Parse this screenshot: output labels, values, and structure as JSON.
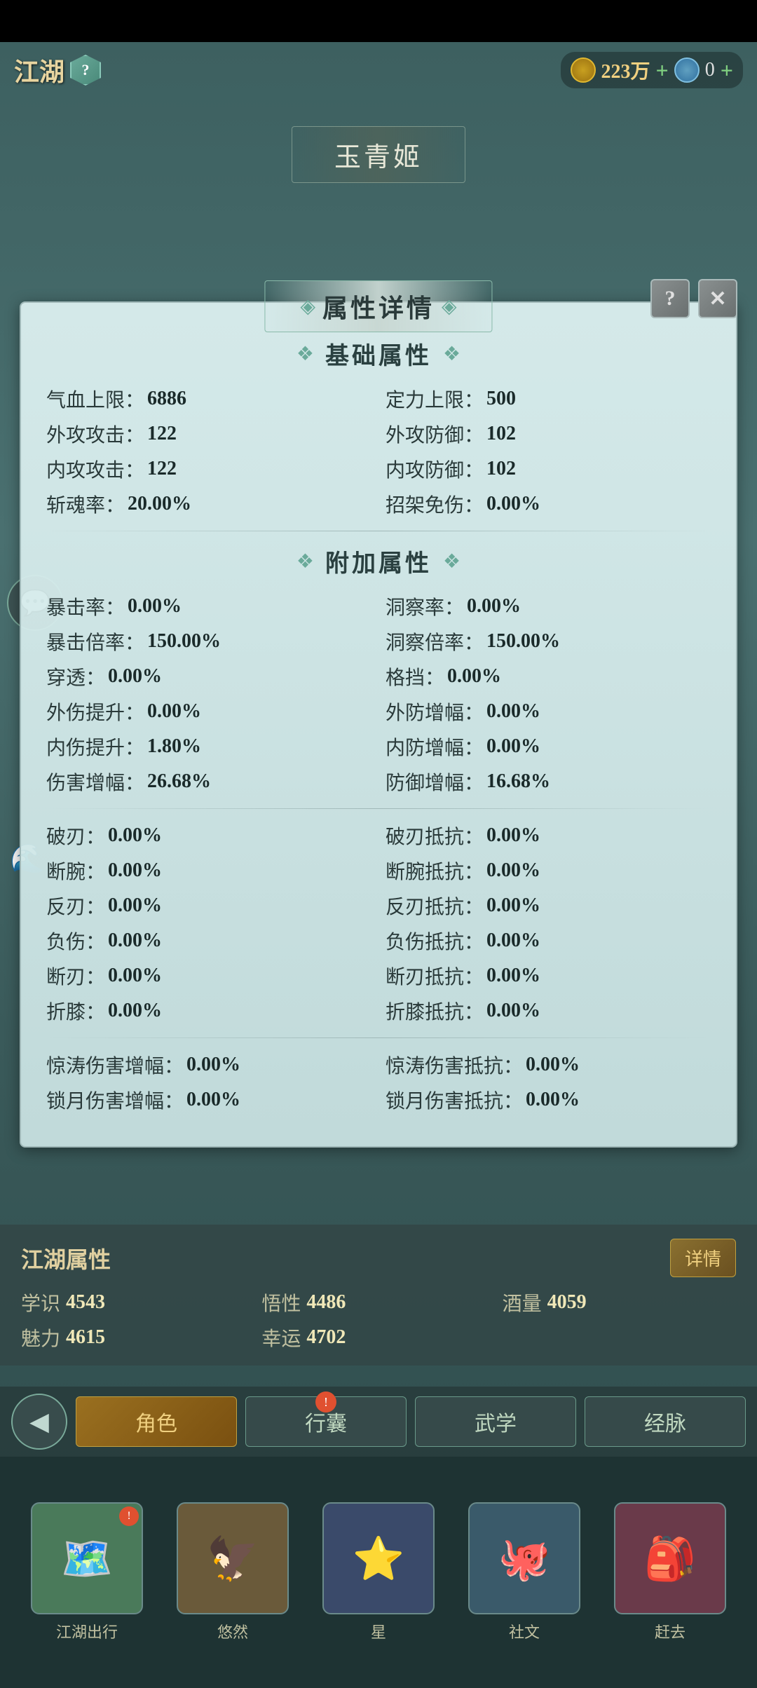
{
  "app": {
    "title": "江湖"
  },
  "top_hud": {
    "jianghu_label": "江湖",
    "question_mark": "?",
    "currency_amount": "223万",
    "currency_plus": "+",
    "gem_count": "0",
    "gem_plus": "+"
  },
  "character": {
    "name": "玉青姬"
  },
  "panel": {
    "title": "属性详情",
    "help_label": "?",
    "close_label": "✕",
    "basic_section": "基础属性",
    "addon_section": "附加属性",
    "deco_left": "❖",
    "deco_right": "❖"
  },
  "basic_stats": [
    {
      "label": "气血上限：",
      "value": "6886",
      "col": "left"
    },
    {
      "label": "定力上限：",
      "value": "500",
      "col": "right"
    },
    {
      "label": "外攻攻击：",
      "value": "122",
      "col": "left"
    },
    {
      "label": "外攻防御：",
      "value": "102",
      "col": "right"
    },
    {
      "label": "内攻攻击：",
      "value": "122",
      "col": "left"
    },
    {
      "label": "内攻防御：",
      "value": "102",
      "col": "right"
    },
    {
      "label": "斩魂率：",
      "value": "20.00%",
      "col": "left"
    },
    {
      "label": "招架免伤：",
      "value": "0.00%",
      "col": "right"
    }
  ],
  "addon_stats": [
    {
      "label": "暴击率：",
      "value": "0.00%",
      "col": "left"
    },
    {
      "label": "洞察率：",
      "value": "0.00%",
      "col": "right"
    },
    {
      "label": "暴击倍率：",
      "value": "150.00%",
      "col": "left"
    },
    {
      "label": "洞察倍率：",
      "value": "150.00%",
      "col": "right"
    },
    {
      "label": "穿透：",
      "value": "0.00%",
      "col": "left"
    },
    {
      "label": "格挡：",
      "value": "0.00%",
      "col": "right"
    },
    {
      "label": "外伤提升：",
      "value": "0.00%",
      "col": "left"
    },
    {
      "label": "外防增幅：",
      "value": "0.00%",
      "col": "right"
    },
    {
      "label": "内伤提升：",
      "value": "1.80%",
      "col": "left"
    },
    {
      "label": "内防增幅：",
      "value": "0.00%",
      "col": "right"
    },
    {
      "label": "伤害增幅：",
      "value": "26.68%",
      "col": "left"
    },
    {
      "label": "防御增幅：",
      "value": "16.68%",
      "col": "right"
    }
  ],
  "special_stats": [
    {
      "label": "破刃：",
      "value": "0.00%",
      "col": "left"
    },
    {
      "label": "破刃抵抗：",
      "value": "0.00%",
      "col": "right"
    },
    {
      "label": "断腕：",
      "value": "0.00%",
      "col": "left"
    },
    {
      "label": "断腕抵抗：",
      "value": "0.00%",
      "col": "right"
    },
    {
      "label": "反刃：",
      "value": "0.00%",
      "col": "left"
    },
    {
      "label": "反刃抵抗：",
      "value": "0.00%",
      "col": "right"
    },
    {
      "label": "负伤：",
      "value": "0.00%",
      "col": "left"
    },
    {
      "label": "负伤抵抗：",
      "value": "0.00%",
      "col": "right"
    },
    {
      "label": "断刃：",
      "value": "0.00%",
      "col": "left"
    },
    {
      "label": "断刃抵抗：",
      "value": "0.00%",
      "col": "right"
    },
    {
      "label": "折膝：",
      "value": "0.00%",
      "col": "left"
    },
    {
      "label": "折膝抵抗：",
      "value": "0.00%",
      "col": "right"
    }
  ],
  "surge_stats": [
    {
      "label": "惊涛伤害增幅：",
      "value": "0.00%",
      "col": "left"
    },
    {
      "label": "惊涛伤害抵抗：",
      "value": "0.00%",
      "col": "right"
    },
    {
      "label": "锁月伤害增幅：",
      "value": "0.00%",
      "col": "left"
    },
    {
      "label": "锁月伤害抵抗：",
      "value": "0.00%",
      "col": "right"
    }
  ],
  "jianghu": {
    "title": "江湖属性",
    "detail_btn": "详情",
    "stats": [
      {
        "label": "学识",
        "value": "4543"
      },
      {
        "label": "悟性",
        "value": "4486"
      },
      {
        "label": "酒量",
        "value": "4059"
      },
      {
        "label": "魅力",
        "value": "4615"
      },
      {
        "label": "幸运",
        "value": "4702"
      }
    ]
  },
  "nav_tabs": [
    {
      "label": "角色",
      "active": true,
      "badge": false
    },
    {
      "label": "行囊",
      "active": false,
      "badge": true
    },
    {
      "label": "武学",
      "active": false,
      "badge": false
    },
    {
      "label": "经脉",
      "active": false,
      "badge": false
    }
  ],
  "bottom_icons": [
    {
      "label": "江湖出行",
      "emoji": "🗺️",
      "badge": true
    },
    {
      "label": "悠然",
      "emoji": "🦅",
      "badge": false
    },
    {
      "label": "星",
      "emoji": "⭐",
      "badge": false
    },
    {
      "label": "社文",
      "emoji": "🐙",
      "badge": false
    },
    {
      "label": "赶去",
      "emoji": "🎒",
      "badge": false
    }
  ],
  "colors": {
    "accent": "#9a7020",
    "panel_bg": "rgba(220,240,240,0.95)",
    "text_primary": "#2a3a3a",
    "text_value": "#1a2a2a",
    "section_color": "#2a4040",
    "deco_color": "#6aaa9a"
  }
}
